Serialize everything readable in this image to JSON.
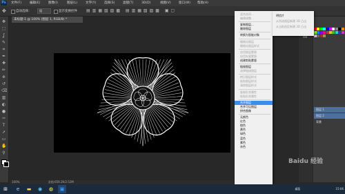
{
  "app": {
    "logo": "Ps"
  },
  "menubar": {
    "items": [
      "文件(F)",
      "编辑(E)",
      "图像(I)",
      "图层(L)",
      "文字(Y)",
      "选择(S)",
      "滤镜(T)",
      "3D(D)",
      "视图(V)",
      "窗口(W)",
      "帮助(H)"
    ]
  },
  "options": {
    "auto_select": "自动选择：",
    "auto_select_value": "组",
    "show_transform": "显示变换控件"
  },
  "document": {
    "tab_label": "未标题-1 @ 100% (图层 1, RGB/8) *",
    "zoom": "100%",
    "doc_info": "文档:659.2K/2.52M"
  },
  "tools": [
    "move-icon",
    "marquee-icon",
    "lasso-icon",
    "quick-select-icon",
    "crop-icon",
    "eyedropper-icon",
    "healing-icon",
    "brush-icon",
    "stamp-icon",
    "history-brush-icon",
    "eraser-icon",
    "gradient-icon",
    "blur-icon",
    "dodge-icon",
    "pen-icon",
    "type-icon",
    "path-select-icon",
    "shape-icon",
    "hand-icon",
    "zoom-icon"
  ],
  "context_menu": {
    "items": [
      {
        "label": "混合选项...",
        "enabled": false
      },
      {
        "label": "编辑调整...",
        "enabled": false
      },
      {
        "sep": true
      },
      {
        "label": "复制图层...",
        "enabled": true
      },
      {
        "label": "删除图层",
        "enabled": true
      },
      {
        "sep": true
      },
      {
        "label": "转换为智能对象",
        "enabled": true
      },
      {
        "sep": true
      },
      {
        "label": "栅格化图层",
        "enabled": false
      },
      {
        "label": "栅格化图层样式",
        "enabled": false
      },
      {
        "sep": true
      },
      {
        "label": "启用图层蒙版",
        "enabled": false
      },
      {
        "label": "启用矢量蒙版",
        "enabled": false
      },
      {
        "label": "创建剪贴蒙版",
        "enabled": true
      },
      {
        "sep": true
      },
      {
        "label": "链接图层",
        "enabled": true
      },
      {
        "label": "选择链接图层",
        "enabled": false
      },
      {
        "sep": true
      },
      {
        "label": "拷贝图层样式",
        "enabled": false
      },
      {
        "label": "粘贴图层样式",
        "enabled": false
      },
      {
        "label": "清除图层样式",
        "enabled": false
      },
      {
        "sep": true
      },
      {
        "label": "复制形状属性",
        "enabled": false
      },
      {
        "label": "粘贴形状属性",
        "enabled": false
      },
      {
        "sep": true
      },
      {
        "label": "合并图层",
        "enabled": true,
        "highlighted": true
      },
      {
        "label": "合并可见图层",
        "enabled": true
      },
      {
        "label": "拼合图像",
        "enabled": true
      },
      {
        "sep": true
      },
      {
        "label": "无颜色",
        "enabled": true
      },
      {
        "label": "红色",
        "enabled": true
      },
      {
        "label": "橙色",
        "enabled": true
      },
      {
        "label": "黄色",
        "enabled": true
      },
      {
        "label": "绿色",
        "enabled": true
      },
      {
        "label": "蓝色",
        "enabled": true
      },
      {
        "label": "紫色",
        "enabled": true
      },
      {
        "label": "灰色",
        "enabled": true
      }
    ]
  },
  "submenu": {
    "items": [
      {
        "label": "明信片",
        "enabled": true
      },
      {
        "label": "从所选图层新建 3D 凸出",
        "enabled": false
      },
      {
        "label": "从当前选区新建 3D 凸出",
        "enabled": false
      }
    ]
  },
  "layers": [
    {
      "label": "图层 1",
      "selected": true
    },
    {
      "label": "图层 2",
      "selected": true
    },
    {
      "label": "背景",
      "selected": false
    }
  ],
  "taskbar": {
    "tray_label": "桌面",
    "time": "15:06"
  },
  "watermark": {
    "text": "Baidu 经验"
  },
  "colors": {
    "highlight": "#3d8ee8",
    "canvas": "#000000",
    "workspace": "#282828"
  }
}
